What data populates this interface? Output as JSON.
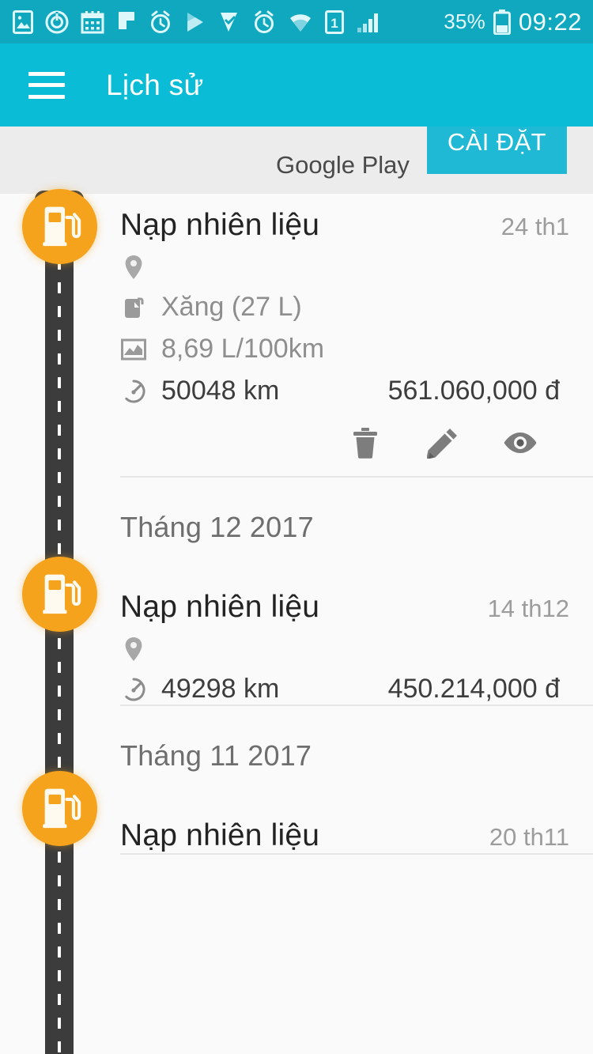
{
  "statusbar": {
    "icons": [
      "image-icon",
      "power-circle-icon",
      "calendar-icon",
      "flag-icon",
      "alarm-icon",
      "play-store-icon",
      "play-music-icon",
      "alarm-2-icon",
      "wifi-icon",
      "sim-1-icon",
      "signal-icon"
    ],
    "sim_label": "1",
    "battery_percent": "35%",
    "clock": "09:22"
  },
  "appbar": {
    "menu_icon": "hamburger-icon",
    "title": "Lịch sử"
  },
  "ad": {
    "label": "Google Play",
    "button_label": "CÀI ĐẶT"
  },
  "colors": {
    "statusbar_bg": "#0fa8bf",
    "appbar_bg": "#0bbcd6",
    "accent_orange": "#f5a21c",
    "road": "#3c3c3c",
    "page_bg": "#fafafa"
  },
  "actions": {
    "delete_label": "delete",
    "edit_label": "edit",
    "view_label": "view"
  },
  "timeline": [
    {
      "kind": "entry",
      "marker_icon": "fuel-pump-icon",
      "title": "Nạp nhiên liệu",
      "date": "24 th1",
      "details": [
        {
          "icon": "location-pin-icon",
          "text": ""
        },
        {
          "icon": "jerrycan-icon",
          "text": "Xăng (27 L)"
        },
        {
          "icon": "chart-line-icon",
          "text": "8,69 L/100km"
        },
        {
          "icon": "odometer-icon",
          "text": "50048 km",
          "amount": "561.060,000 đ"
        }
      ],
      "has_actions": true
    },
    {
      "kind": "month",
      "label": "Tháng 12 2017"
    },
    {
      "kind": "entry",
      "marker_icon": "fuel-pump-icon",
      "title": "Nạp nhiên liệu",
      "date": "14 th12",
      "details": [
        {
          "icon": "location-pin-icon",
          "text": ""
        },
        {
          "icon": "odometer-icon",
          "text": "49298 km",
          "amount": "450.214,000 đ"
        }
      ],
      "has_actions": false
    },
    {
      "kind": "month",
      "label": "Tháng 11 2017"
    },
    {
      "kind": "entry",
      "marker_icon": "fuel-pump-icon",
      "title": "Nạp nhiên liệu",
      "date": "20 th11",
      "details": [],
      "has_actions": false
    }
  ]
}
